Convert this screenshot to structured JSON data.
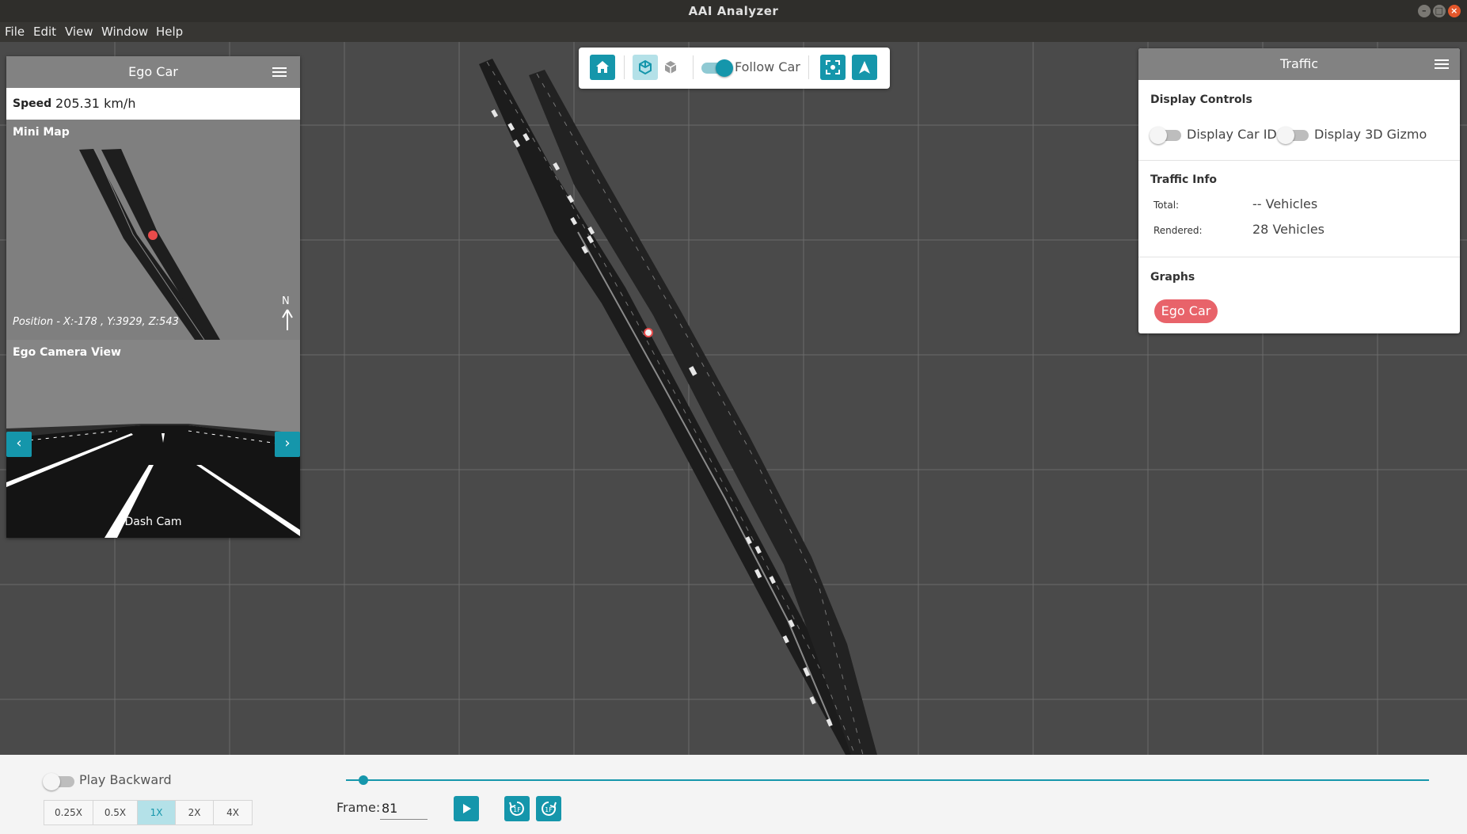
{
  "window": {
    "title": "AAI Analyzer"
  },
  "menu": {
    "items": [
      "File",
      "Edit",
      "View",
      "Window",
      "Help"
    ]
  },
  "toolbar": {
    "follow_car_label": "Follow Car",
    "follow_car_on": true,
    "icons": [
      "home-icon",
      "cube-3d-active-icon",
      "cube-3d-icon",
      "focus-icon",
      "navigate-icon"
    ]
  },
  "ego_panel": {
    "title": "Ego Car",
    "speed_label": "Speed",
    "speed_value": "205.31 km/h",
    "minimap_label": "Mini Map",
    "position_text": "Position - X:-178 , Y:3929, Z:543",
    "north_label": "N",
    "camera_label": "Ego Camera View",
    "dash_cam_label": "Dash Cam"
  },
  "traffic_panel": {
    "title": "Traffic",
    "display_controls_title": "Display Controls",
    "display_car_id_label": "Display Car ID",
    "display_3d_gizmo_label": "Display 3D Gizmo",
    "display_car_id_on": false,
    "display_3d_gizmo_on": false,
    "traffic_info_title": "Traffic Info",
    "total_label": "Total:",
    "total_value": "-- Vehicles",
    "rendered_label": "Rendered:",
    "rendered_value": "28 Vehicles",
    "graphs_title": "Graphs",
    "ego_car_chip": "Ego Car"
  },
  "bottom_bar": {
    "play_backward_label": "Play Backward",
    "play_backward_on": false,
    "speed_options": [
      "0.25X",
      "0.5X",
      "1X",
      "2X",
      "4X"
    ],
    "selected_speed": "1X",
    "frame_label": "Frame:",
    "frame_value": "81",
    "timeline_progress": 0.015,
    "step_back_label": "1F",
    "step_forward_label": "1F"
  },
  "colors": {
    "accent": "#1596ab",
    "chip": "#e8636a",
    "ego_marker": "#e84b4b"
  }
}
